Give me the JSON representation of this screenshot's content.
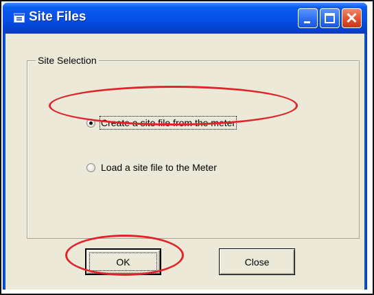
{
  "window": {
    "title": "Site Files",
    "controls": {
      "minimize_icon": "minimize-icon",
      "maximize_icon": "maximize-icon",
      "close_icon": "close-icon",
      "close_glyph": "✕"
    }
  },
  "site_selection": {
    "group_label": "Site Selection",
    "options": [
      {
        "label": "Create a site file from the meter",
        "selected": true
      },
      {
        "label": "Load a site file to the Meter",
        "selected": false
      }
    ]
  },
  "buttons": {
    "ok_label": "OK",
    "close_label": "Close"
  },
  "colors": {
    "titlebar": "#0650e6",
    "annotation": "#e0242a",
    "dialog_face": "#ece9d8"
  }
}
